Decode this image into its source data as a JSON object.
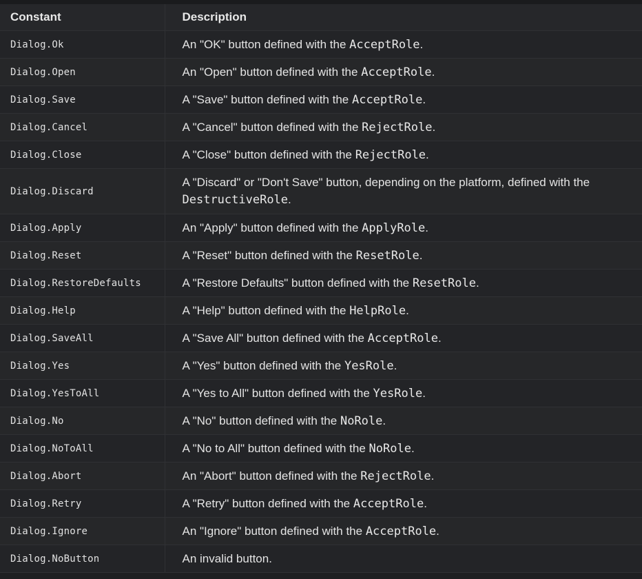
{
  "table": {
    "headers": {
      "constant": "Constant",
      "description": "Description"
    },
    "rows": [
      {
        "constant": "Dialog.Ok",
        "pre": "An \"OK\" button defined with the ",
        "code": "AcceptRole",
        "post": "."
      },
      {
        "constant": "Dialog.Open",
        "pre": "An \"Open\" button defined with the ",
        "code": "AcceptRole",
        "post": "."
      },
      {
        "constant": "Dialog.Save",
        "pre": "A \"Save\" button defined with the ",
        "code": "AcceptRole",
        "post": "."
      },
      {
        "constant": "Dialog.Cancel",
        "pre": "A \"Cancel\" button defined with the ",
        "code": "RejectRole",
        "post": "."
      },
      {
        "constant": "Dialog.Close",
        "pre": "A \"Close\" button defined with the ",
        "code": "RejectRole",
        "post": "."
      },
      {
        "constant": "Dialog.Discard",
        "pre": "A \"Discard\" or \"Don't Save\" button, depending on the platform, defined with the ",
        "code": "DestructiveRole",
        "post": "."
      },
      {
        "constant": "Dialog.Apply",
        "pre": "An \"Apply\" button defined with the ",
        "code": "ApplyRole",
        "post": "."
      },
      {
        "constant": "Dialog.Reset",
        "pre": "A \"Reset\" button defined with the ",
        "code": "ResetRole",
        "post": "."
      },
      {
        "constant": "Dialog.RestoreDefaults",
        "pre": "A \"Restore Defaults\" button defined with the ",
        "code": "ResetRole",
        "post": "."
      },
      {
        "constant": "Dialog.Help",
        "pre": "A \"Help\" button defined with the ",
        "code": "HelpRole",
        "post": "."
      },
      {
        "constant": "Dialog.SaveAll",
        "pre": "A \"Save All\" button defined with the ",
        "code": "AcceptRole",
        "post": "."
      },
      {
        "constant": "Dialog.Yes",
        "pre": "A \"Yes\" button defined with the ",
        "code": "YesRole",
        "post": "."
      },
      {
        "constant": "Dialog.YesToAll",
        "pre": "A \"Yes to All\" button defined with the ",
        "code": "YesRole",
        "post": "."
      },
      {
        "constant": "Dialog.No",
        "pre": "A \"No\" button defined with the ",
        "code": "NoRole",
        "post": "."
      },
      {
        "constant": "Dialog.NoToAll",
        "pre": "A \"No to All\" button defined with the ",
        "code": "NoRole",
        "post": "."
      },
      {
        "constant": "Dialog.Abort",
        "pre": "An \"Abort\" button defined with the ",
        "code": "RejectRole",
        "post": "."
      },
      {
        "constant": "Dialog.Retry",
        "pre": "A \"Retry\" button defined with the ",
        "code": "AcceptRole",
        "post": "."
      },
      {
        "constant": "Dialog.Ignore",
        "pre": "An \"Ignore\" button defined with the ",
        "code": "AcceptRole",
        "post": "."
      },
      {
        "constant": "Dialog.NoButton",
        "pre": "An invalid button.",
        "code": "",
        "post": ""
      }
    ]
  }
}
